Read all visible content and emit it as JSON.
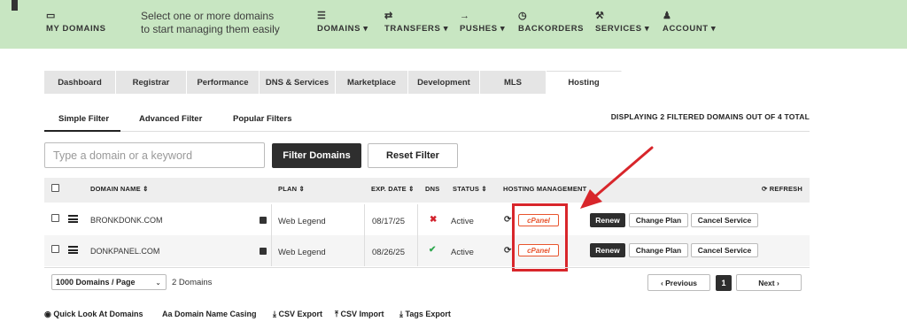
{
  "nav": {
    "my_domains": "MY DOMAINS",
    "subtitle_line1": "Select one or more domains",
    "subtitle_line2": "to start managing them easily",
    "items": [
      {
        "label": "DOMAINS ▾",
        "icon": "list-icon"
      },
      {
        "label": "TRANSFERS ▾",
        "icon": "transfer-icon"
      },
      {
        "label": "PUSHES ▾",
        "icon": "arrow-right-icon"
      },
      {
        "label": "BACKORDERS",
        "icon": "clock-icon"
      },
      {
        "label": "SERVICES ▾",
        "icon": "wrench-icon"
      },
      {
        "label": "ACCOUNT ▾",
        "icon": "user-icon"
      }
    ]
  },
  "tabs": [
    "Dashboard",
    "Registrar",
    "Performance",
    "DNS & Services",
    "Marketplace",
    "Development",
    "MLS",
    "Hosting"
  ],
  "active_tab": "Hosting",
  "filters": {
    "simple": "Simple Filter",
    "advanced": "Advanced Filter",
    "popular": "Popular Filters",
    "displaying": "DISPLAYING 2 FILTERED DOMAINS OUT OF 4 TOTAL"
  },
  "search": {
    "placeholder": "Type a domain or a keyword",
    "filter_button": "Filter Domains",
    "reset_button": "Reset Filter"
  },
  "table": {
    "headers": {
      "domain": "DOMAIN NAME ⇕",
      "plan": "PLAN ⇕",
      "exp": "EXP. DATE ⇕",
      "dns": "DNS",
      "status": "STATUS ⇕",
      "hosting": "HOSTING MANAGEMENT",
      "refresh": "⟳ REFRESH"
    },
    "rows": [
      {
        "domain": "BRONKDONK.COM",
        "plan": "Web Legend",
        "exp": "08/17/25",
        "dns": "fail",
        "status": "Active",
        "cpanel": "cPanel"
      },
      {
        "domain": "DONKPANEL.COM",
        "plan": "Web Legend",
        "exp": "08/26/25",
        "dns": "ok",
        "status": "Active",
        "cpanel": "cPanel"
      }
    ],
    "actions": {
      "renew": "Renew",
      "change_plan": "Change Plan",
      "cancel": "Cancel Service"
    }
  },
  "pagination": {
    "per_page": "1000 Domains / Page",
    "count": "2 Domains",
    "prev": "‹ Previous",
    "current": "1",
    "next": "Next ›"
  },
  "tools": [
    "Quick Look At Domains",
    "Domain Name Casing",
    "CSV Export",
    "CSV Import",
    "Tags Export"
  ],
  "colors": {
    "nav_bg": "#c8e6c2",
    "highlight": "#d8262b",
    "cpanel": "#e8542d",
    "dns_fail": "#d2222d",
    "dns_ok": "#2fa84f"
  }
}
